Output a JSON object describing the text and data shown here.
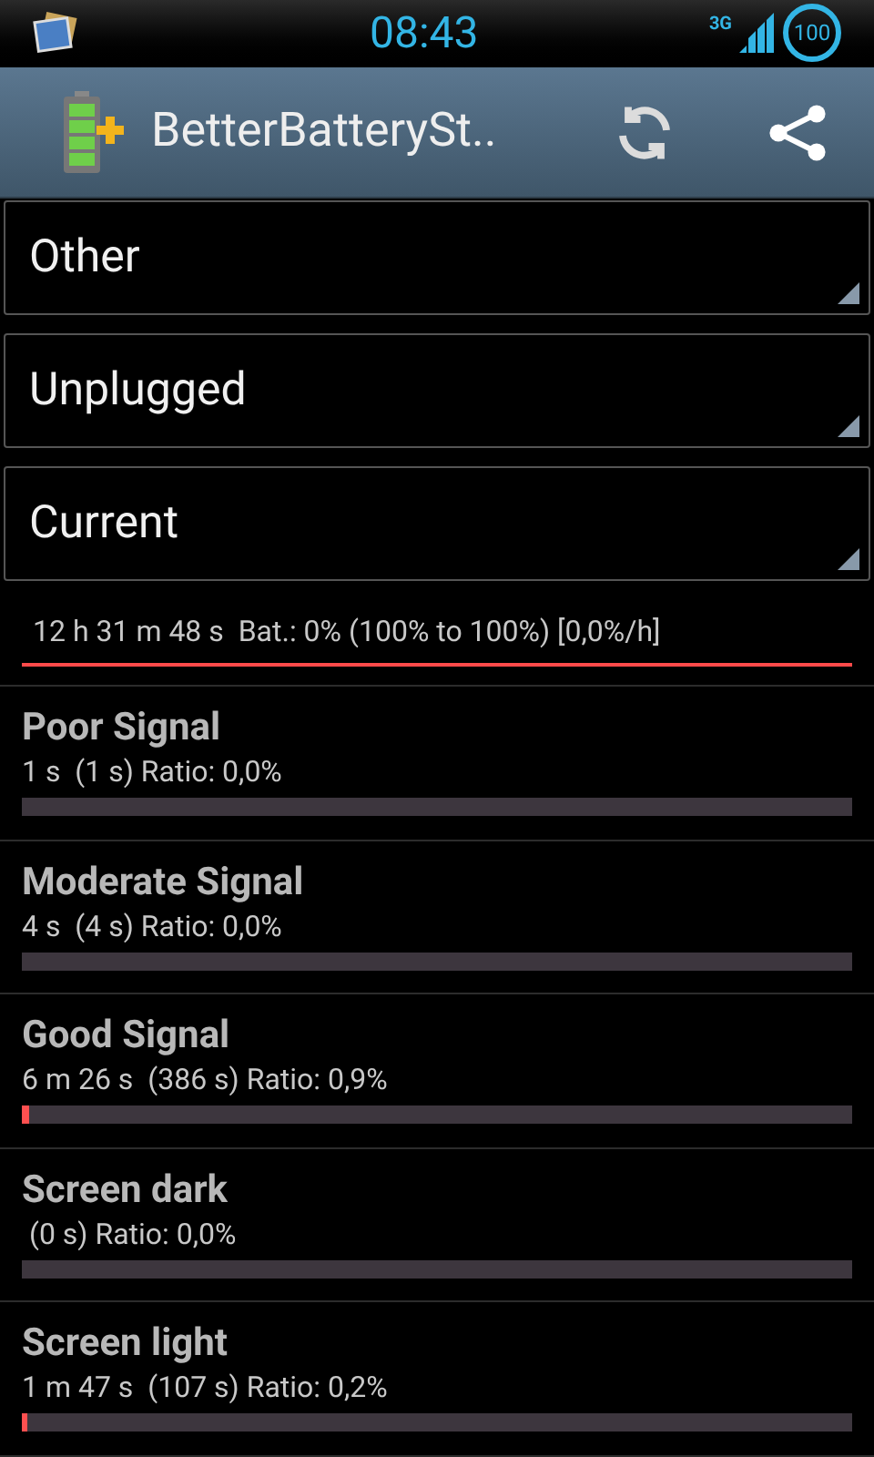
{
  "status_bar": {
    "time": "08:43",
    "network": "3G",
    "battery": "100"
  },
  "action_bar": {
    "title": "BetterBatterySt.."
  },
  "spinners": [
    {
      "label": "Other"
    },
    {
      "label": "Unplugged"
    },
    {
      "label": "Current"
    }
  ],
  "summary": {
    "text": "12 h 31 m 48 s  Bat.: 0% (100% to 100%) [0,0%/h]",
    "level": 1
  },
  "rows": [
    {
      "title": "Poor Signal",
      "detail": "1 s  (1 s) Ratio: 0,0%"
    },
    {
      "title": "Moderate Signal",
      "detail": "4 s  (4 s) Ratio: 0,0%"
    },
    {
      "title": "Good Signal",
      "detail": "6 m 26 s  (386 s) Ratio: 0,9%",
      "level": 0.009
    },
    {
      "title": "Screen dark",
      "detail": " (0 s) Ratio: 0,0%"
    },
    {
      "title": "Screen light",
      "detail": "1 m 47 s  (107 s) Ratio: 0,2%",
      "level": 0.002
    }
  ]
}
